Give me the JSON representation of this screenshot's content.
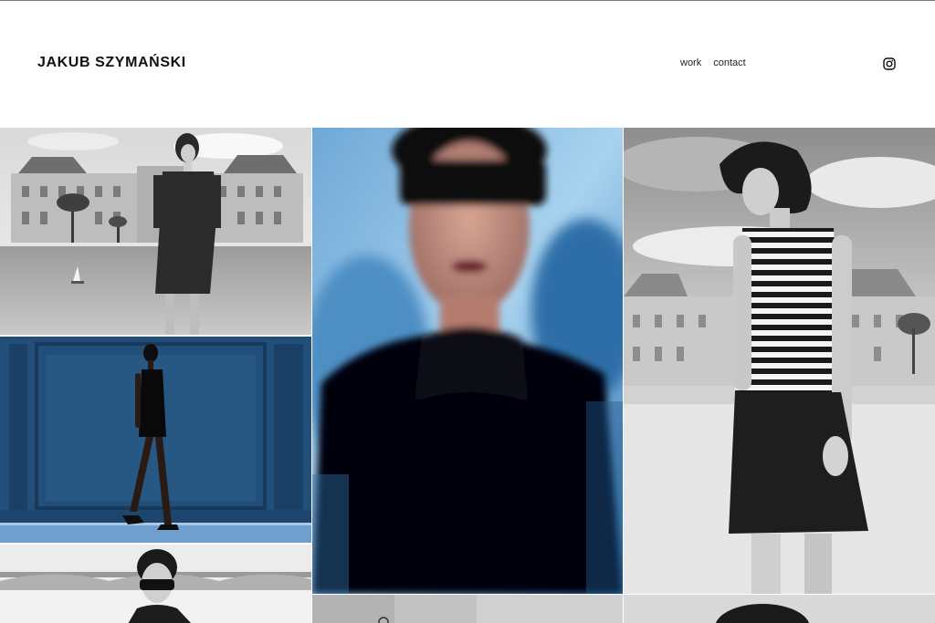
{
  "site": {
    "title": "JAKUB SZYMAŃSKI"
  },
  "nav": {
    "items": [
      {
        "label": "work"
      },
      {
        "label": "contact"
      }
    ]
  },
  "social": {
    "icon": "instagram-icon"
  },
  "gallery": {
    "photos": [
      {
        "name": "photo-paris-fountain-denim-dress",
        "tone": "bw"
      },
      {
        "name": "photo-sunglasses-blurred-portrait",
        "tone": "color-blue"
      },
      {
        "name": "photo-striped-top-leather-skirt",
        "tone": "bw"
      },
      {
        "name": "photo-blue-wall-walking-model",
        "tone": "color-blue"
      },
      {
        "name": "photo-bridge-sunglasses-portrait",
        "tone": "bw"
      },
      {
        "name": "photo-stone-wall-partial",
        "tone": "bw"
      },
      {
        "name": "photo-dark-hair-partial",
        "tone": "bw"
      }
    ]
  },
  "colors": {
    "text": "#111111",
    "background": "#ffffff",
    "blue_wall": "#1e4a70",
    "sky_blue": "#8fc3e8"
  }
}
